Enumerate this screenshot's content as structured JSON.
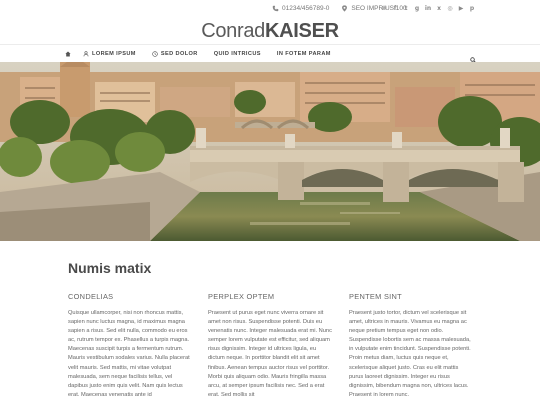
{
  "topbar": {
    "phone": "01234/456789-0",
    "address": "SEO IMPRIUS 100",
    "socials": [
      {
        "icon": "mail-icon",
        "glyph": "✉"
      },
      {
        "icon": "facebook-icon",
        "glyph": "f"
      },
      {
        "icon": "twitter-icon",
        "glyph": "t"
      },
      {
        "icon": "google-plus-icon",
        "glyph": "g"
      },
      {
        "icon": "linkedin-icon",
        "glyph": "in"
      },
      {
        "icon": "xing-icon",
        "glyph": "x"
      },
      {
        "icon": "instagram-icon",
        "glyph": "◎"
      },
      {
        "icon": "youtube-icon",
        "glyph": "▶"
      },
      {
        "icon": "pinterest-icon",
        "glyph": "p"
      }
    ]
  },
  "logo": {
    "light": "Conrad",
    "bold": "KAISER"
  },
  "nav": {
    "items": [
      {
        "label": "LOREM IPSUM",
        "icon": "user-icon"
      },
      {
        "label": "SED DOLOR",
        "icon": "clock-icon"
      },
      {
        "label": "QUID INTRICUS",
        "icon": ""
      },
      {
        "label": "IN FOTEM PARAM",
        "icon": ""
      }
    ]
  },
  "main": {
    "heading": "Numis matix",
    "columns": [
      {
        "title": "CONDELIAS",
        "text": "Quisque ullamcorper, nisi non rhoncus mattis, sapien nunc luctus magna, id maximus magna sapien a risus. Sed elit nulla, commodo eu eros ac, rutrum tempor ex. Phasellus a turpis magna. Maecenas suscipit turpis a fermentum rutrum. Mauris vestibulum sodales varius. Nulla placerat velit mauris. Sed mattis, mi vitae volutpat malesuada, sem neque facilisis tellus, vel dapibus justo enim quis velit. Nam quis lectus erat. Maecenas venenatis ante id"
      },
      {
        "title": "PERPLEX OPTEM",
        "text": "Praesent ut purus eget nunc viverra ornare sit amet non risus. Suspendisse potenti. Duis eu venenatis nunc. Integer malesuada erat mi. Nunc semper lorem vulputate est efficitur, sed aliquam risus dignissim. Integer id ultrices ligula, eu dictum neque. In porttitor blandit elit sit amet finibus. Aenean tempus auctor risus vel porttitor. Morbi quis aliquam odio. Mauris fringilla massa arcu, at semper ipsum facilisis nec. Sed a erat erat. Sed mollis sit"
      },
      {
        "title": "PENTEM SINT",
        "text": "Praesent justo tortor, dictum vel scelerisque sit amet, ultrices in mauris. Vivamus eu magna ac neque pretium tempus eget non odio. Suspendisse lobortis sem ac massa malesuada, in vulputate enim tincidunt. Suspendisse potenti. Proin metus diam, luctus quis neque et, scelerisque aliquet justo. Cras eu elit mattis purus laoreet dignissim. Integer eu risus dignissim, bibendum magna non, ultrices lacus. Praesent in lorem nunc."
      }
    ]
  }
}
